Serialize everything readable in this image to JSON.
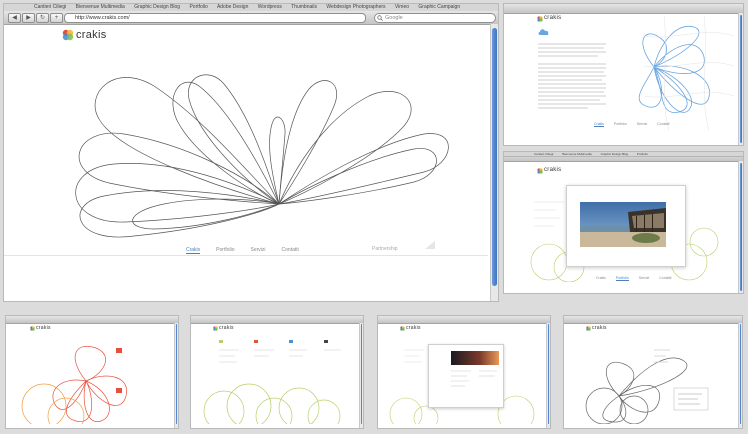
{
  "browser": {
    "bookmarks": [
      "Cantieri Ciliegi",
      "Bienvenue Multimedia",
      "Graphic Design Blog",
      "Portfolio",
      "Adobe Design",
      "Wordpress",
      "Thumbnails",
      "Webdesign Photographers",
      "Vimeo",
      "Graphic Campaign"
    ],
    "url": "http://www.crakis.com/",
    "search_placeholder": "Google",
    "back_glyph": "◀",
    "forward_glyph": "▶",
    "reload_glyph": "↻",
    "add_glyph": "+"
  },
  "site": {
    "logo": "crakis",
    "menu": [
      "Crakis",
      "Portfolio",
      "Servizi",
      "Contatti"
    ],
    "footer_note": "Partnership"
  },
  "colors": {
    "accent": "#4a7fc0",
    "blue_lines": "#6aa6e0",
    "green_lines": "#b8d06a",
    "red_lines": "#e8503e",
    "orange_lines": "#f2a24a",
    "dark_lines": "#666666"
  },
  "icons": {
    "logo": "crakis-logo-icon",
    "search": "search-icon"
  }
}
